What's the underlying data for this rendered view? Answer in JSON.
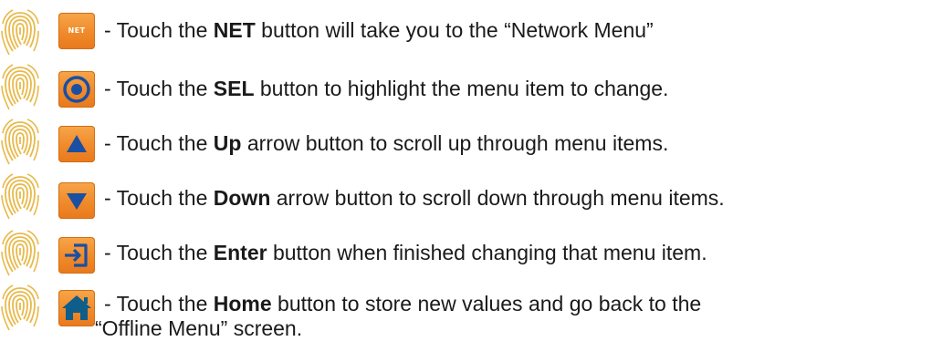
{
  "colors": {
    "button_orange": "#f08a2a",
    "icon_blue": "#1a4fa3",
    "fingerprint": "#e8b94a"
  },
  "rows": [
    {
      "icon": "net-button-icon",
      "net_label": "NET",
      "pre": "- Touch the ",
      "bold": "NET",
      "post": " button will take you to the “Network Menu”"
    },
    {
      "icon": "select-target-icon",
      "pre": "- Touch the ",
      "bold": "SEL",
      "post": " button to highlight the menu item to change."
    },
    {
      "icon": "up-arrow-icon",
      "pre": "- Touch the ",
      "bold": "Up",
      "post": " arrow button to scroll up through menu items."
    },
    {
      "icon": "down-arrow-icon",
      "pre": "- Touch the ",
      "bold": "Down",
      "post": " arrow button to scroll down through menu items."
    },
    {
      "icon": "enter-icon",
      "pre": "- Touch the ",
      "bold": "Enter",
      "post": " button when finished changing that menu item."
    },
    {
      "icon": "home-icon",
      "pre": "- Touch the ",
      "bold": "Home",
      "post": " button to store new values and go back to the",
      "line2": "“Offline Menu” screen."
    }
  ]
}
